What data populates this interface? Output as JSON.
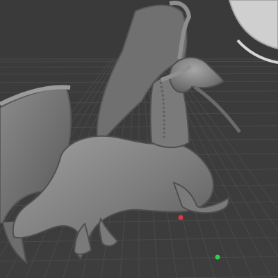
{
  "viewport": {
    "background_color": "#3b3b3b",
    "grid_color": "#4a4a4a",
    "model_color": "#7d7d7d",
    "model_shadow_color": "#4f4f4f",
    "model_highlight_color": "#9d9d9d",
    "gizmo_point_red": "#e0354a",
    "gizmo_point_green": "#2fd14a",
    "object": "dragon-sculpt-model"
  }
}
